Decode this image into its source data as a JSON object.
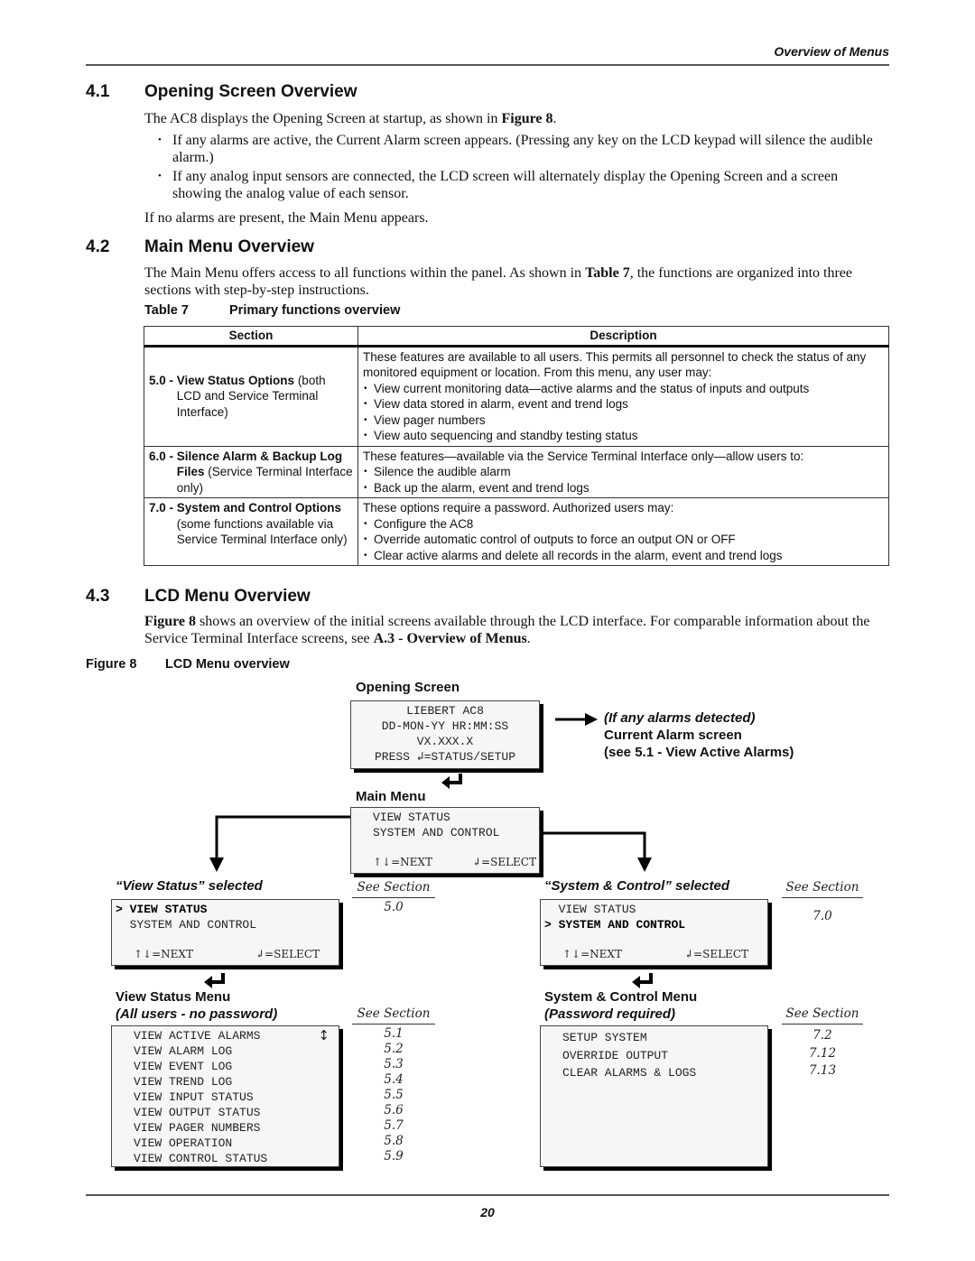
{
  "running_head": "Overview of Menus",
  "sections": {
    "s41": {
      "number": "4.1",
      "title": "Opening Screen Overview",
      "intro_pre": "The AC8 displays the Opening Screen at startup, as shown in ",
      "intro_ref": "Figure 8",
      "intro_post": ".",
      "bullets": [
        "If any alarms are active, the Current Alarm screen appears. (Pressing any key on the LCD keypad will silence the audible alarm.)",
        "If any analog input sensors are connected, the LCD screen will alternately display the Opening Screen and a screen showing the analog value of each sensor."
      ],
      "closing": "If no alarms are present, the Main Menu appears."
    },
    "s42": {
      "number": "4.2",
      "title": "Main Menu Overview",
      "intro_pre": "The Main Menu offers access to all functions within the panel. As shown in ",
      "intro_ref": "Table 7",
      "intro_post": ", the functions are organized into three sections with step-by-step instructions."
    },
    "s43": {
      "number": "4.3",
      "title": "LCD Menu Overview",
      "intro_ref": "Figure 8",
      "intro_mid": " shows an overview of the initial screens available through the LCD interface. For comparable information about the Service Terminal Interface screens, see ",
      "intro_ref2": "A.3 - Overview of Menus",
      "intro_post": "."
    }
  },
  "table7": {
    "caption_label": "Table 7",
    "caption_title": "Primary functions overview",
    "headers": [
      "Section",
      "Description"
    ],
    "rows": [
      {
        "num": "5.0 - ",
        "title": "View Status Options",
        "note": "(both LCD and Service Terminal Interface)",
        "desc": "These features are available to all users. This permits all personnel to check the status of any monitored equipment or location. From this menu, any user may:",
        "items": [
          "View current monitoring data—active alarms and the status of inputs and outputs",
          "View data stored in alarm, event and trend logs",
          "View pager numbers",
          "View auto sequencing and standby testing status"
        ]
      },
      {
        "num": "6.0 - ",
        "title": "Silence Alarm & Backup Log Files",
        "note": "(Service Terminal Interface only)",
        "desc": "These features—available via the Service Terminal Interface only—allow users to:",
        "items": [
          "Silence the audible alarm",
          "Back up the alarm, event and trend logs"
        ]
      },
      {
        "num": "7.0 - ",
        "title": "System and Control Options",
        "note": "(some functions available via Service Terminal Interface only)",
        "desc": "These options require a password. Authorized users may:",
        "items": [
          "Configure the AC8",
          "Override automatic control of outputs to force an output ON or OFF",
          "Clear active alarms and delete all records in the alarm, event and trend logs"
        ]
      }
    ]
  },
  "figure8": {
    "caption_label": "Figure 8",
    "caption_title": "LCD Menu overview",
    "opening_screen": {
      "label": "Opening Screen",
      "lines": [
        "LIEBERT AC8",
        "DD-MON-YY HR:MM:SS",
        "VX.XXX.X",
        "PRESS ↲=STATUS/SETUP"
      ]
    },
    "alarm_note": {
      "line1": "(If any alarms detected)",
      "line2": "Current Alarm screen",
      "line3": "(see 5.1 - View Active Alarms)"
    },
    "main_menu": {
      "label": "Main Menu",
      "lines": [
        "VIEW STATUS",
        "SYSTEM AND CONTROL"
      ],
      "nav_next": "↑↓=NEXT",
      "nav_select": "↲=SELECT"
    },
    "view_status_selected": {
      "label": "“View Status” selected",
      "selected_marker": ">",
      "lines": [
        "VIEW STATUS",
        "SYSTEM AND CONTROL"
      ],
      "selected_index": 0,
      "nav_next": "↑↓=NEXT",
      "nav_select": "↲=SELECT",
      "see_section_header": "See Section",
      "see_section": "5.0"
    },
    "system_control_selected": {
      "label": "“System & Control” selected",
      "selected_marker": ">",
      "lines": [
        "VIEW STATUS",
        "SYSTEM AND CONTROL"
      ],
      "selected_index": 1,
      "nav_next": "↑↓=NEXT",
      "nav_select": "↲=SELECT",
      "see_section_header": "See Section",
      "see_section": "7.0"
    },
    "view_status_menu": {
      "label": "View Status Menu",
      "sublabel": "(All users - no password)",
      "see_section_header": "See Section",
      "scroll_indicator": "↕",
      "items": [
        {
          "text": "VIEW ACTIVE ALARMS",
          "section": "5.1"
        },
        {
          "text": "VIEW ALARM LOG",
          "section": "5.2"
        },
        {
          "text": "VIEW EVENT LOG",
          "section": "5.3"
        },
        {
          "text": "VIEW TREND LOG",
          "section": "5.4"
        },
        {
          "text": "VIEW INPUT STATUS",
          "section": "5.5"
        },
        {
          "text": "VIEW OUTPUT STATUS",
          "section": "5.6"
        },
        {
          "text": "VIEW PAGER NUMBERS",
          "section": "5.7"
        },
        {
          "text": "VIEW OPERATION",
          "section": "5.8"
        },
        {
          "text": "VIEW CONTROL STATUS",
          "section": "5.9"
        }
      ]
    },
    "system_control_menu": {
      "label": "System & Control Menu",
      "sublabel": "(Password required)",
      "see_section_header": "See Section",
      "items": [
        {
          "text": "SETUP SYSTEM",
          "section": "7.2"
        },
        {
          "text": "OVERRIDE OUTPUT",
          "section": "7.12"
        },
        {
          "text": "CLEAR ALARMS & LOGS",
          "section": "7.13"
        }
      ]
    }
  },
  "page_number": "20"
}
